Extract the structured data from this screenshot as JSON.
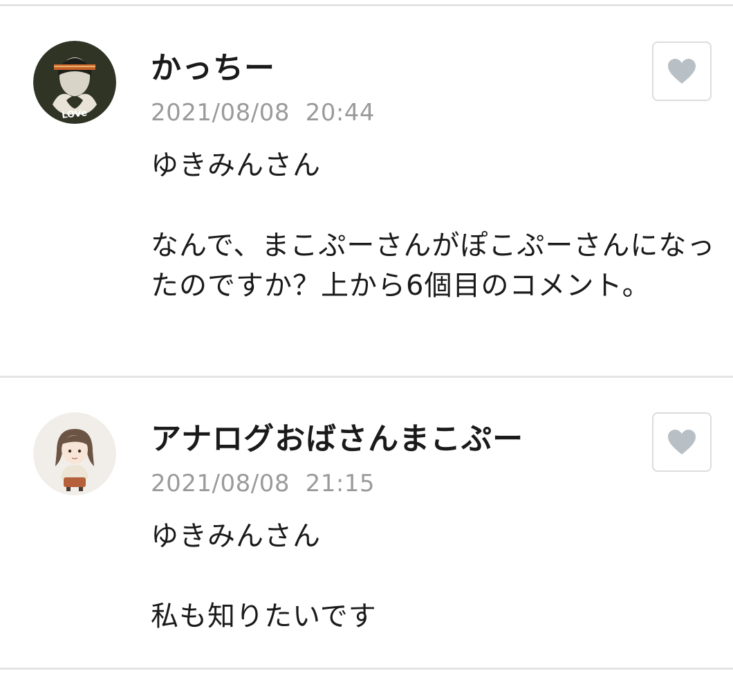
{
  "comments": [
    {
      "author": "かっちー",
      "datetime": "2021/08/08  20:44",
      "body": "ゆきみんさん\n\nなんで、まこぷーさんがぽこぷーさんになったのですか？上から6個目のコメント。",
      "avatar_icon": "love-heart-hands-avatar",
      "like_icon": "heart-icon"
    },
    {
      "author": "アナログおばさんまこぷー",
      "datetime": "2021/08/08  21:15",
      "body": "ゆきみんさん\n\n私も知りたいです",
      "avatar_icon": "illustrated-woman-avatar",
      "like_icon": "heart-icon"
    }
  ],
  "colors": {
    "divider": "#e3e3e3",
    "date_text": "#9a9a9a",
    "heart": "#b9c0c5",
    "like_border": "#dcdcdc"
  }
}
